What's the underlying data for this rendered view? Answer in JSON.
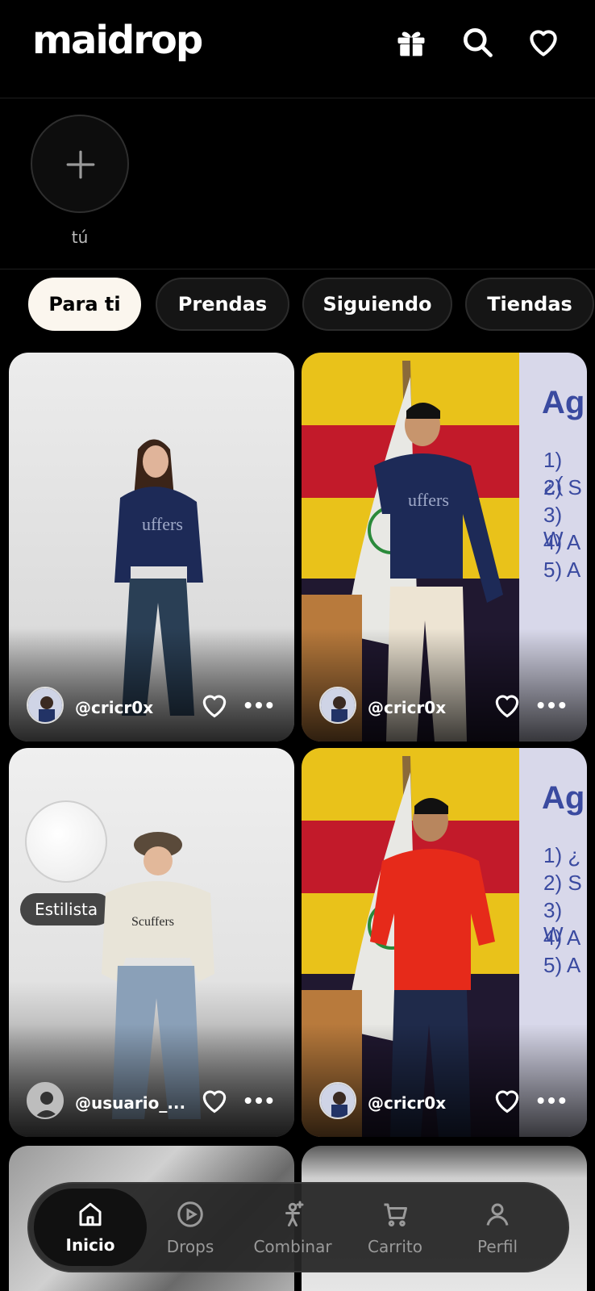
{
  "header": {
    "logo": "maidrop",
    "icons": [
      "gift-icon",
      "search-icon",
      "heart-icon"
    ]
  },
  "stories": {
    "add_label": "tú"
  },
  "filters": [
    {
      "label": "Para ti",
      "active": true
    },
    {
      "label": "Prendas",
      "active": false
    },
    {
      "label": "Siguiendo",
      "active": false
    },
    {
      "label": "Tiendas",
      "active": false
    }
  ],
  "feed": [
    {
      "username": "@cricr0x"
    },
    {
      "username": "@cricr0x",
      "slide_title": "Ag",
      "slide_lines": [
        "1) ¿(",
        "2) S",
        "3) W",
        "4) A",
        "5) A"
      ]
    },
    {
      "username": "@usuario_...",
      "badge": "Estilista"
    },
    {
      "username": "@cricr0x",
      "slide_title": "Ag",
      "slide_lines": [
        "1) ¿",
        "2) S",
        "3) W",
        "4) A",
        "5) A"
      ]
    }
  ],
  "nav": [
    {
      "label": "Inicio",
      "icon": "home-icon",
      "active": true
    },
    {
      "label": "Drops",
      "icon": "play-icon",
      "active": false
    },
    {
      "label": "Combinar",
      "icon": "outfit-icon",
      "active": false
    },
    {
      "label": "Carrito",
      "icon": "cart-icon",
      "active": false
    },
    {
      "label": "Perfil",
      "icon": "user-icon",
      "active": false
    }
  ]
}
